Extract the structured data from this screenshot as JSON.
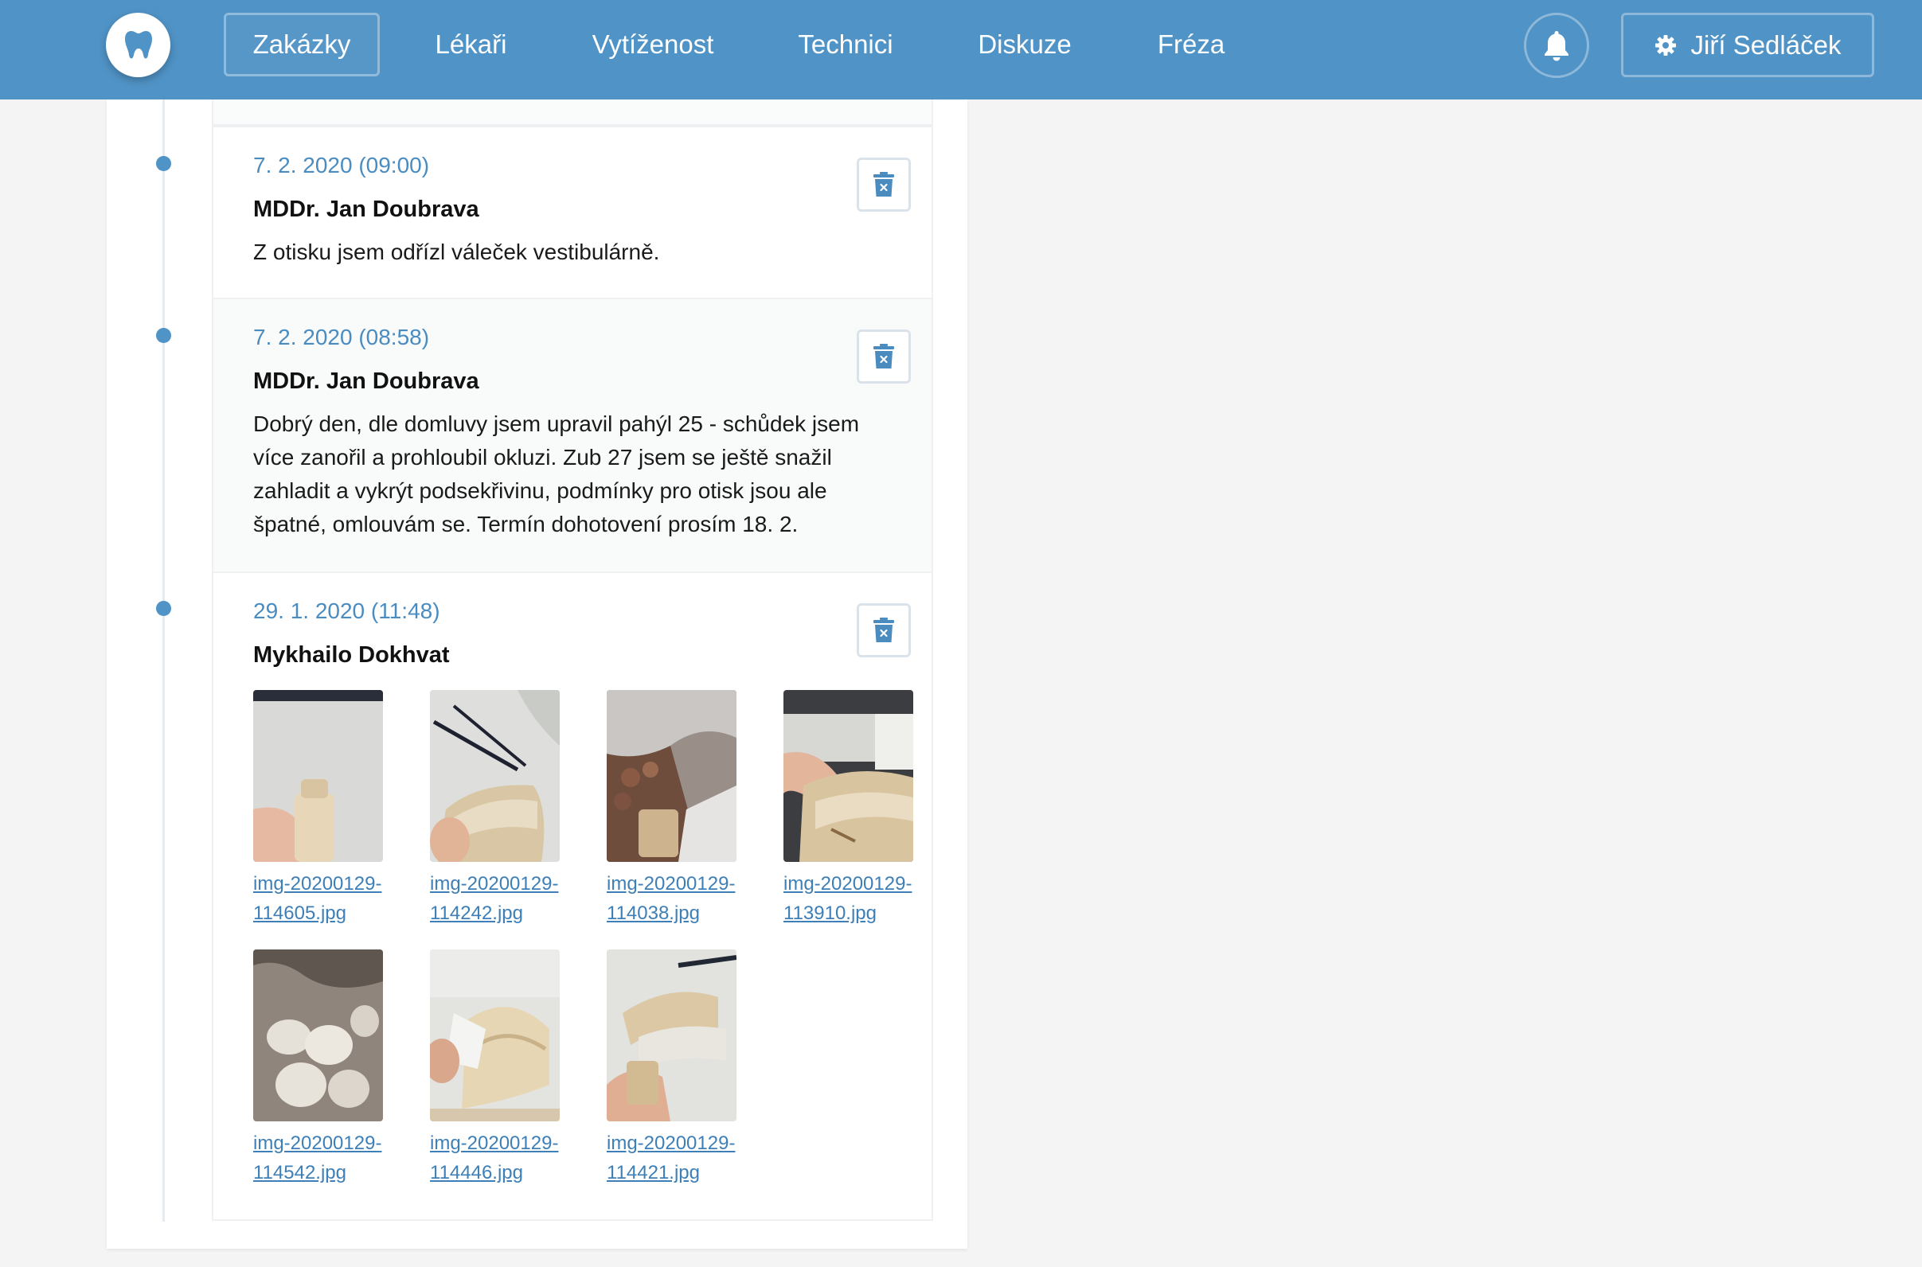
{
  "nav": {
    "items": [
      {
        "label": "Zakázky",
        "active": true
      },
      {
        "label": "Lékaři"
      },
      {
        "label": "Vytíženost"
      },
      {
        "label": "Technici"
      },
      {
        "label": "Diskuze"
      },
      {
        "label": "Fréza"
      }
    ],
    "user_name": "Jiří Sedláček",
    "logo_icon": "tooth-icon",
    "bell_icon": "bell-icon",
    "settings_icon": "gear-icon"
  },
  "colors": {
    "navbar": "#5093c6",
    "accent": "#4a8cc0",
    "link": "#3d7fb6",
    "page_bg": "#f3f4f3"
  },
  "comments": [
    {
      "date": "7. 2. 2020 (09:00)",
      "author": "MDDr. Jan Doubrava",
      "text": "Z otisku jsem odřízl váleček vestibulárně."
    },
    {
      "date": "7. 2. 2020 (08:58)",
      "author": "MDDr. Jan Doubrava",
      "text": "Dobrý den, dle domluvy jsem upravil pahýl 25 - schůdek jsem více zanořil a prohloubil okluzi. Zub 27 jsem se ještě snažil zahladit a vykrýt podsekřivinu, podmínky pro otisk jsou ale špatné, omlouvám se. Termín dohotovení prosím 18. 2."
    },
    {
      "date": "29. 1. 2020 (11:48)",
      "author": "Mykhailo Dokhvat",
      "attachments": [
        "img-20200129-114605.jpg",
        "img-20200129-114242.jpg",
        "img-20200129-114038.jpg",
        "img-20200129-113910.jpg",
        "img-20200129-114542.jpg",
        "img-20200129-114446.jpg",
        "img-20200129-114421.jpg"
      ]
    }
  ]
}
